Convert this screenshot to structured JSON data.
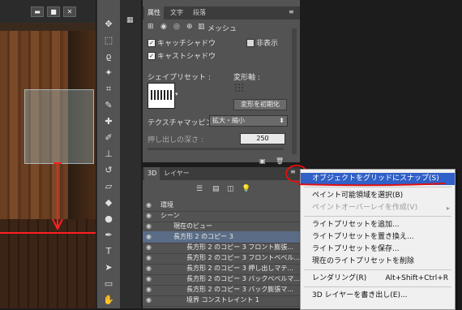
{
  "window": {
    "min_symbol": "▬",
    "max_symbol": "■",
    "close_symbol": "✕"
  },
  "properties": {
    "tabs": [
      "属性",
      "文字",
      "段落"
    ],
    "mesh_label": "メッシュ",
    "catch_shadow": {
      "label": "キャッチシャドウ",
      "checked": true
    },
    "cast_shadow": {
      "label": "キャストシャドウ",
      "checked": true
    },
    "invisible": {
      "label": "非表示",
      "checked": false
    },
    "shape_preset_label": "シェイプリセット :",
    "deform_axis_label": "変形軸 :",
    "reset_deform_button": "変形を初期化",
    "texture_mapping_label": "テクスチャマッピング :",
    "texture_mapping_value": "拡大・縮小",
    "extrusion_depth_label": "押し出しの深さ :",
    "extrusion_depth_value": "250"
  },
  "panel3d": {
    "tabs": [
      "3D",
      "レイヤー"
    ],
    "rows": [
      {
        "label": "環境",
        "indent": 0,
        "selected": false
      },
      {
        "label": "シーン",
        "indent": 0,
        "selected": false
      },
      {
        "label": "現在のビュー",
        "indent": 1,
        "selected": false
      },
      {
        "label": "長方形 2 のコピー 3",
        "indent": 1,
        "selected": true
      },
      {
        "label": "長方形 2 のコピー 3 フロント膨張...",
        "indent": 2,
        "selected": false
      },
      {
        "label": "長方形 2 のコピー 3 フロントベベル...",
        "indent": 2,
        "selected": false
      },
      {
        "label": "長方形 2 のコピー 3 押し出しマテ...",
        "indent": 2,
        "selected": false
      },
      {
        "label": "長方形 2 のコピー 3 バックベベルマ...",
        "indent": 2,
        "selected": false
      },
      {
        "label": "長方形 2 のコピー 3 バック膨張マ...",
        "indent": 2,
        "selected": false
      },
      {
        "label": "境界 コンストレイント 1",
        "indent": 2,
        "selected": false
      }
    ]
  },
  "menu": {
    "items": [
      {
        "label": "オブジェクトをグリッドにスナップ(S)",
        "highlight": true,
        "disabled": false
      },
      {
        "sep": true
      },
      {
        "label": "ペイント可能領域を選択(B)",
        "highlight": false,
        "disabled": false
      },
      {
        "label": "ペイントオーバーレイを作成(V)",
        "highlight": false,
        "disabled": true,
        "submenu": true
      },
      {
        "sep": true
      },
      {
        "label": "ライトプリセットを追加...",
        "highlight": false,
        "disabled": false
      },
      {
        "label": "ライトプリセットを置き換え...",
        "highlight": false,
        "disabled": false
      },
      {
        "label": "ライトプリセットを保存...",
        "highlight": false,
        "disabled": false
      },
      {
        "label": "現在のライトプリセットを削除",
        "highlight": false,
        "disabled": false
      },
      {
        "sep": true
      },
      {
        "label": "レンダリング(R)",
        "shortcut": "Alt+Shift+Ctrl+R",
        "highlight": false,
        "disabled": false
      },
      {
        "sep": true
      },
      {
        "label": "3D レイヤーを書き出し(E)...",
        "highlight": false,
        "disabled": false
      }
    ]
  },
  "colors": {
    "accent": "#3060c8",
    "annotation": "#e01010"
  }
}
